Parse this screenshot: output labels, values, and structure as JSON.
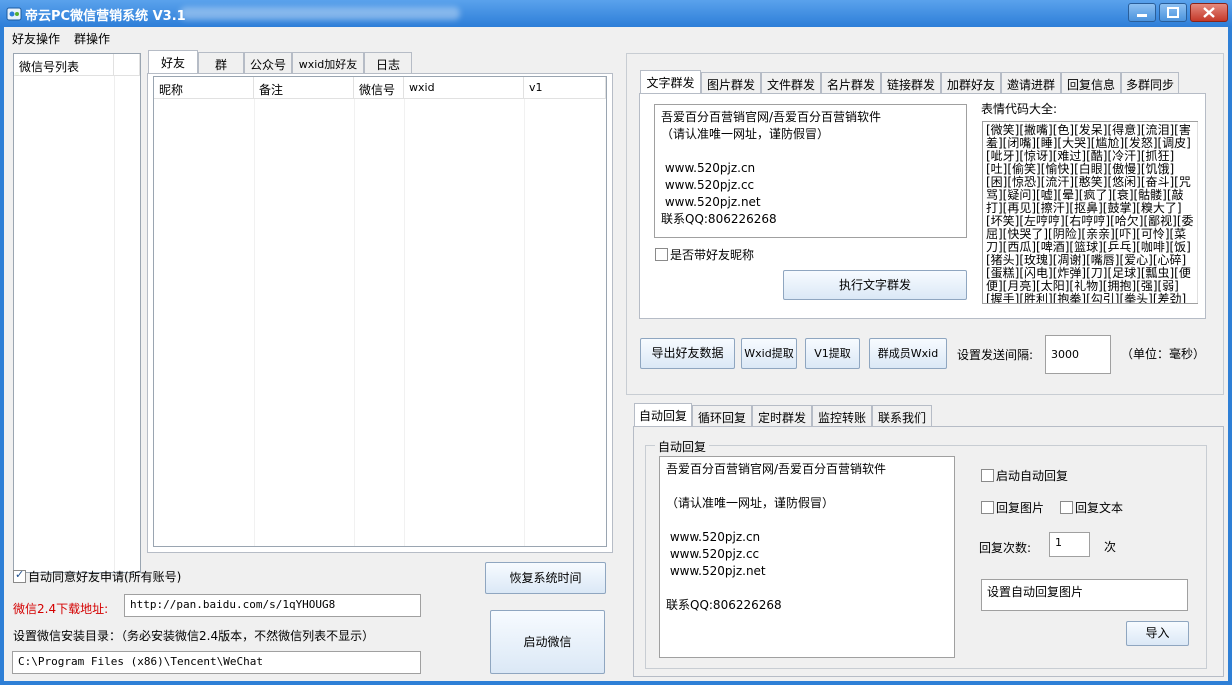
{
  "window": {
    "title": "帝云PC微信营销系统 V3.1"
  },
  "menu": {
    "friends": "好友操作",
    "groups": "群操作"
  },
  "account_list": {
    "header": "微信号列表"
  },
  "left_tabs": [
    "好友",
    "群",
    "公众号",
    "wxid加好友",
    "日志"
  ],
  "friend_table": {
    "columns": [
      "昵称",
      "备注",
      "微信号",
      "wxid",
      "v1"
    ]
  },
  "bottom_left": {
    "auto_accept_label": "自动同意好友申请(所有账号)",
    "download_label": "微信2.4下载地址:",
    "download_url": "http://pan.baidu.com/s/1qYHOUG8",
    "install_dir_label": "设置微信安装目录：（务必安装微信2.4版本，不然微信列表不显示）",
    "install_dir": "C:\\Program Files (x86)\\Tencent\\WeChat",
    "restore_time_button": "恢复系统时间",
    "start_wechat_button": "启动微信"
  },
  "top_right_tabs": [
    "文字群发",
    "图片群发",
    "文件群发",
    "名片群发",
    "链接群发",
    "加群好友",
    "邀请进群",
    "回复信息",
    "多群同步"
  ],
  "mass_text": {
    "message": "吾爱百分百营销官网/吾爱百分百营销软件\n（请认准唯一网址，谨防假冒）\n\n www.520pjz.cn\n www.520pjz.cc\n www.520pjz.net\n联系QQ:806226268",
    "with_nickname_label": "是否带好友昵称",
    "execute_button": "执行文字群发",
    "emoji_title": "表情代码大全:",
    "emoji_codes": "[微笑][撇嘴][色][发呆][得意][流泪][害羞][闭嘴][睡][大哭][尴尬][发怒][调皮][呲牙][惊讶][难过][酷][冷汗][抓狂][吐][偷笑][愉快][白眼][傲慢][饥饿][困][惊恐][流汗][憨笑][悠闲][奋斗][咒骂][疑问][嘘][晕][疯了][衰][骷髅][敲打][再见][擦汗][抠鼻][鼓掌][糗大了][坏笑][左哼哼][右哼哼][哈欠][鄙视][委屈][快哭了][阴险][亲亲][吓][可怜][菜刀][西瓜][啤酒][篮球][乒乓][咖啡][饭][猪头][玫瑰][凋谢][嘴唇][爱心][心碎][蛋糕][闪电][炸弹][刀][足球][瓢虫][便便][月亮][太阳][礼物][拥抱][强][弱][握手][胜利][抱拳][勾引][拳头][差劲]"
  },
  "tools": {
    "export_button": "导出好友数据",
    "wxid_button": "Wxid提取",
    "v1_button": "V1提取",
    "group_member_button": "群成员Wxid",
    "interval_label": "设置发送间隔:",
    "interval_value": "3000",
    "unit_label": "（单位：毫秒）"
  },
  "bottom_right_tabs": [
    "自动回复",
    "循环回复",
    "定时群发",
    "监控转账",
    "联系我们"
  ],
  "auto_reply": {
    "group_title": "自动回复",
    "message": "吾爱百分百营销官网/吾爱百分百营销软件\n\n（请认准唯一网址，谨防假冒）\n\n www.520pjz.cn\n www.520pjz.cc\n www.520pjz.net\n\n联系QQ:806226268",
    "enable_label": "启动自动回复",
    "reply_image_label": "回复图片",
    "reply_text_label": "回复文本",
    "count_label": "回复次数:",
    "count_value": "1",
    "count_unit": "次",
    "image_box_label": "设置自动回复图片",
    "import_button": "导入"
  },
  "colors": {
    "title_bar": "#2d7ed8",
    "window_bg": "#f0f0f0",
    "download_label": "#d40000"
  }
}
